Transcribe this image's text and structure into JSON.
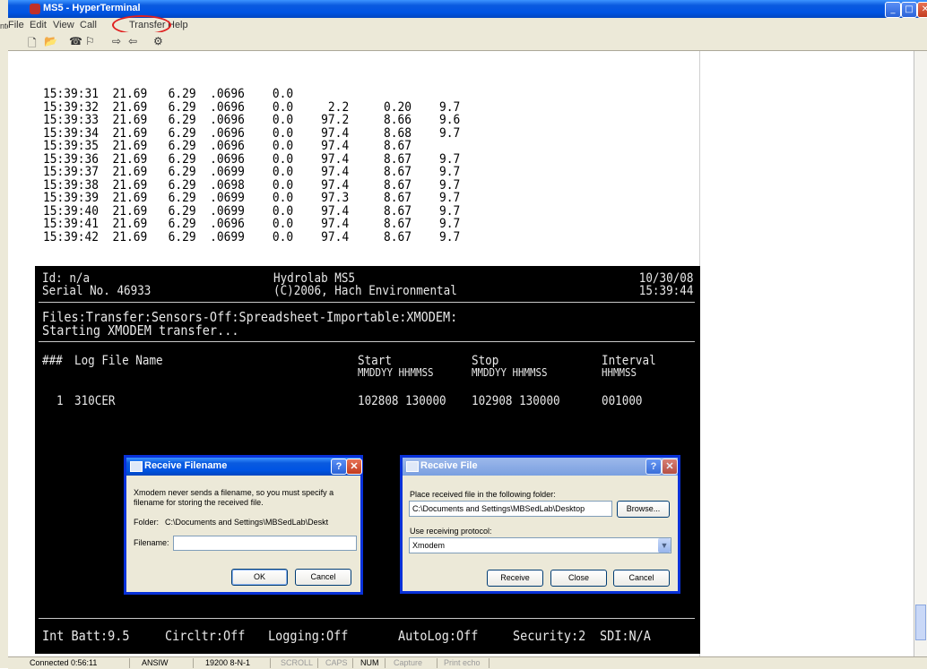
{
  "window": {
    "title": "MS5 - HyperTerminal",
    "left_stub_text": "nter",
    "controls": {
      "minimize": "_",
      "maximize": "□",
      "close": "✕"
    }
  },
  "menu": [
    "File",
    "Edit",
    "View",
    "Call",
    "Transfer",
    "Help"
  ],
  "toolbar_icons": [
    "new-icon",
    "open-icon",
    "disconnect-icon",
    "phone-icon",
    "send-icon",
    "receive-icon",
    "properties-icon"
  ],
  "terminal_lines": [
    "15:39:31  21.69   6.29  .0696    0.0",
    "15:39:32  21.69   6.29  .0696    0.0     2.2     0.20    9.7",
    "15:39:33  21.69   6.29  .0696    0.0    97.2     8.66    9.6",
    "15:39:34  21.69   6.29  .0696    0.0    97.4     8.68    9.7",
    "15:39:35  21.69   6.29  .0696    0.0    97.4     8.67",
    "15:39:36  21.69   6.29  .0696    0.0    97.4     8.67    9.7",
    "15:39:37  21.69   6.29  .0699    0.0    97.4     8.67    9.7",
    "15:39:38  21.69   6.29  .0698    0.0    97.4     8.67    9.7",
    "15:39:39  21.69   6.29  .0699    0.0    97.3     8.67    9.7",
    "15:39:40  21.69   6.29  .0699    0.0    97.4     8.67    9.7",
    "15:39:41  21.69   6.29  .0696    0.0    97.4     8.67    9.7",
    "15:39:42  21.69   6.29  .0699    0.0    97.4     8.67    9.7"
  ],
  "screen": {
    "id": "Id: n/a",
    "serial": "Serial No. 46933",
    "product": "Hydrolab MS5",
    "copyright": "(C)2006, Hach Environmental",
    "date": "10/30/08",
    "time": "15:39:44",
    "path": "Files:Transfer:Sensors-Off:Spreadsheet-Importable:XMODEM:",
    "status": "Starting XMODEM transfer...",
    "col_num": "###",
    "col_name": "Log File Name",
    "col_start": "Start",
    "col_start_sub": "MMDDYY HHMMSS",
    "col_stop": "Stop",
    "col_stop_sub": "MMDDYY HHMMSS",
    "col_interval": "Interval",
    "col_interval_sub": "HHMMSS",
    "row": {
      "num": "1",
      "name": "310CER",
      "start": "102808 130000",
      "stop": "102908 130000",
      "interval": "001000"
    },
    "footer": {
      "batt": "Int Batt:9.5",
      "circ": "Circltr:Off",
      "logging": "Logging:Off",
      "autolog": "AutoLog:Off",
      "security": "Security:2",
      "sdi": "SDI:N/A"
    }
  },
  "dialog_filename": {
    "title": "Receive Filename",
    "help": "?",
    "close": "✕",
    "message": "Xmodem never sends a filename, so you must specify a filename for storing the received file.",
    "folder_label": "Folder:",
    "folder_value": "C:\\Documents and Settings\\MBSedLab\\Deskt",
    "filename_label": "Filename:",
    "filename_value": "",
    "ok": "OK",
    "cancel": "Cancel"
  },
  "dialog_receive": {
    "title": "Receive File",
    "help": "?",
    "close": "✕",
    "folder_label": "Place received file in the following folder:",
    "folder_value": "C:\\Documents and Settings\\MBSedLab\\Desktop",
    "browse": "Browse...",
    "protocol_label": "Use receiving protocol:",
    "protocol_value": "Xmodem",
    "receive": "Receive",
    "close_btn": "Close",
    "cancel": "Cancel"
  },
  "statusbar": {
    "connected": "Connected 0:56:11",
    "emulation": "ANSIW",
    "settings": "19200 8-N-1",
    "scroll": "SCROLL",
    "caps": "CAPS",
    "num": "NUM",
    "capture": "Capture",
    "print": "Print echo"
  }
}
